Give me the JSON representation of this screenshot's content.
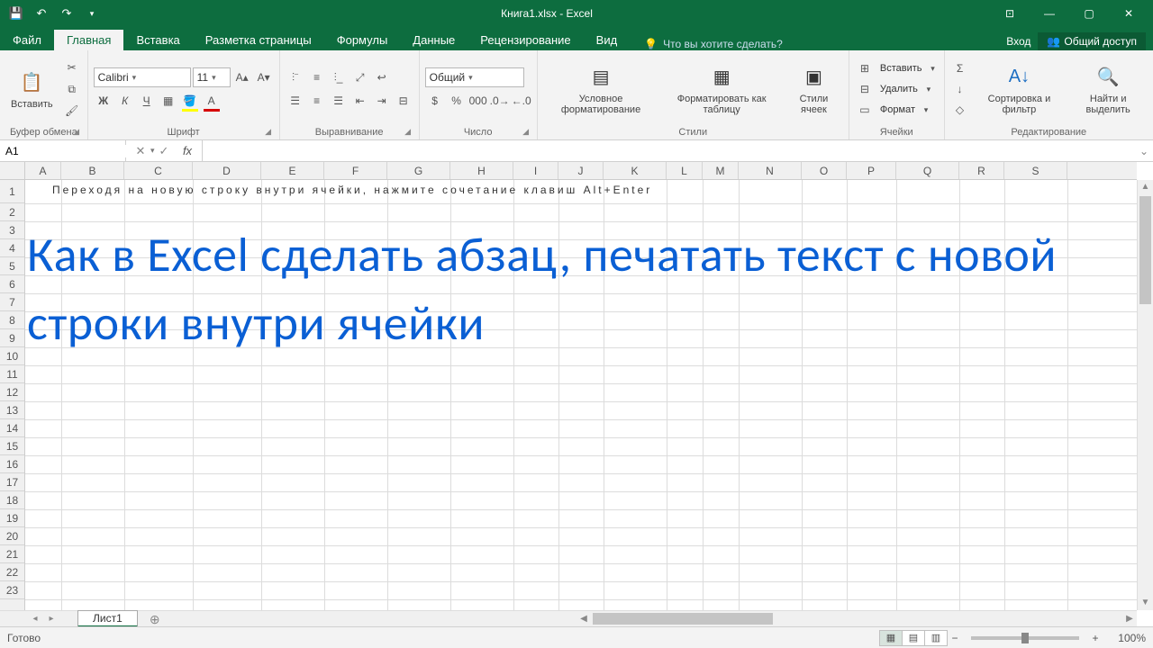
{
  "title": "Книга1.xlsx - Excel",
  "qat": [
    "save",
    "undo",
    "redo"
  ],
  "tabs": {
    "file": "Файл",
    "home": "Главная",
    "insert": "Вставка",
    "pagelayout": "Разметка страницы",
    "formulas": "Формулы",
    "data": "Данные",
    "review": "Рецензирование",
    "view": "Вид",
    "tellme": "Что вы хотите сделать?"
  },
  "account": {
    "signin": "Вход",
    "share": "Общий доступ"
  },
  "ribbon": {
    "clipboard": {
      "label": "Буфер обмена",
      "paste": "Вставить"
    },
    "font": {
      "label": "Шрифт",
      "name": "Calibri",
      "size": "11",
      "bold": "Ж",
      "italic": "К",
      "underline": "Ч"
    },
    "alignment": {
      "label": "Выравнивание"
    },
    "number": {
      "label": "Число",
      "format": "Общий"
    },
    "styles": {
      "label": "Стили",
      "conditional": "Условное\nформатирование",
      "table": "Форматировать\nкак таблицу",
      "cell": "Стили\nячеек"
    },
    "cells": {
      "label": "Ячейки",
      "insert": "Вставить",
      "delete": "Удалить",
      "format": "Формат"
    },
    "editing": {
      "label": "Редактирование",
      "sortfilter": "Сортировка\nи фильтр",
      "findselect": "Найти и\nвыделить"
    }
  },
  "namebox": "A1",
  "formula": "",
  "columns": [
    "A",
    "B",
    "C",
    "D",
    "E",
    "F",
    "G",
    "H",
    "I",
    "J",
    "K",
    "L",
    "M",
    "N",
    "O",
    "P",
    "Q",
    "R",
    "S"
  ],
  "rows": [
    "1",
    "2",
    "3",
    "4",
    "5",
    "6",
    "7",
    "8",
    "9",
    "10",
    "11",
    "12",
    "13",
    "14",
    "15",
    "16",
    "17",
    "18",
    "19",
    "20",
    "21",
    "22",
    "23"
  ],
  "cell_a1_text": "Переходя на новую строку внутри ячейки, нажмите сочетание клавиш Alt+Enter",
  "overlay_text": "Как в Excel сделать абзац, печатать текст с новой строки внутри ячейки",
  "sheets": {
    "active": "Лист1"
  },
  "status": {
    "ready": "Готово",
    "zoom": "100%"
  }
}
